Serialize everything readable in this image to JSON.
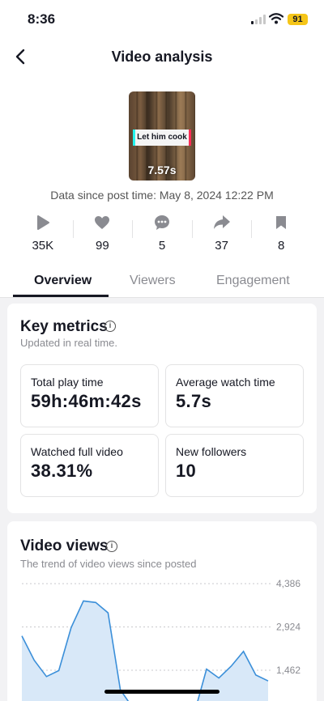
{
  "status_bar": {
    "time": "8:36",
    "battery": "91"
  },
  "header": {
    "title": "Video analysis"
  },
  "video": {
    "caption": "Let him cook",
    "duration": "7.57s",
    "data_since": "Data since post time: May 8, 2024 12:22 PM"
  },
  "stats": [
    {
      "icon": "play-icon",
      "value": "35K"
    },
    {
      "icon": "heart-icon",
      "value": "99"
    },
    {
      "icon": "comment-icon",
      "value": "5"
    },
    {
      "icon": "share-icon",
      "value": "37"
    },
    {
      "icon": "bookmark-icon",
      "value": "8"
    }
  ],
  "tabs": [
    {
      "label": "Overview",
      "active": true
    },
    {
      "label": "Viewers"
    },
    {
      "label": "Engagement"
    }
  ],
  "key_metrics": {
    "title": "Key metrics",
    "subtitle": "Updated in real time.",
    "items": [
      {
        "label": "Total play time",
        "value": "59h:46m:42s"
      },
      {
        "label": "Average watch time",
        "value": "5.7s"
      },
      {
        "label": "Watched full video",
        "value": "38.31%"
      },
      {
        "label": "New followers",
        "value": "10"
      }
    ]
  },
  "video_views": {
    "title": "Video views",
    "subtitle": "The trend of video views since posted"
  },
  "chart_data": {
    "type": "area",
    "title": "",
    "xlabel": "",
    "ylabel": "",
    "y_ticks": [
      "4,386",
      "2,924",
      "1,462"
    ],
    "y_tick_values": [
      4386,
      2924,
      1462
    ],
    "ylim": [
      0,
      4386
    ],
    "grid": true,
    "x": [
      0,
      1,
      2,
      3,
      4,
      5,
      6,
      7,
      8,
      9,
      10,
      11,
      12,
      13,
      14,
      15,
      16,
      17,
      18,
      19,
      20
    ],
    "values": [
      2620,
      1800,
      1250,
      1450,
      2900,
      3800,
      3750,
      3400,
      800,
      200,
      0,
      0,
      0,
      0,
      0,
      1500,
      1200,
      1600,
      2100,
      1300,
      1100
    ],
    "color": "#3b8fd9"
  },
  "colors": {
    "accent": "#161823",
    "chart_line": "#3b8fd9",
    "chart_fill": "#d8e8f8",
    "battery": "#f5c518"
  }
}
